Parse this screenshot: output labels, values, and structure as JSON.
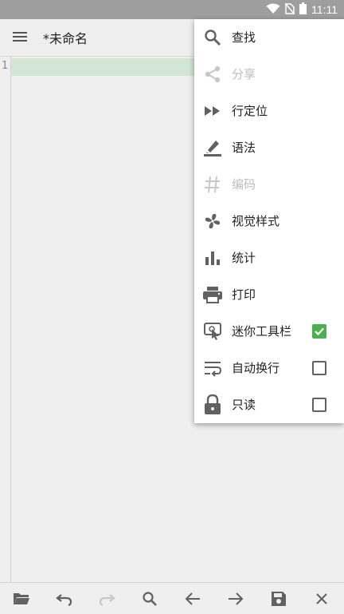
{
  "status_bar": {
    "time": "11:11",
    "icons": [
      "wifi-icon",
      "no-sim-icon",
      "battery-icon"
    ]
  },
  "app_bar": {
    "title": "*未命名",
    "menu_icon": "hamburger-menu-icon"
  },
  "editor": {
    "line_numbers": [
      "1"
    ],
    "text": ""
  },
  "menu": {
    "items": [
      {
        "label": "查找",
        "icon": "search-icon",
        "enabled": true
      },
      {
        "label": "分享",
        "icon": "share-icon",
        "enabled": false
      },
      {
        "label": "行定位",
        "icon": "fast-forward-icon",
        "enabled": true
      },
      {
        "label": "语法",
        "icon": "highlighter-icon",
        "enabled": true
      },
      {
        "label": "编码",
        "icon": "hash-icon",
        "enabled": false
      },
      {
        "label": "视觉样式",
        "icon": "fan-icon",
        "enabled": true
      },
      {
        "label": "统计",
        "icon": "bar-chart-icon",
        "enabled": true
      },
      {
        "label": "打印",
        "icon": "printer-icon",
        "enabled": true
      },
      {
        "label": "迷你工具栏",
        "icon": "touch-icon",
        "enabled": true,
        "checked": true
      },
      {
        "label": "自动换行",
        "icon": "wrap-text-icon",
        "enabled": true,
        "checked": false
      },
      {
        "label": "只读",
        "icon": "lock-icon",
        "enabled": true,
        "checked": false
      }
    ]
  },
  "bottom_bar": {
    "buttons": [
      "folder-open-icon",
      "undo-icon",
      "redo-icon",
      "search-icon",
      "arrow-left-icon",
      "arrow-right-icon",
      "save-icon",
      "close-icon"
    ]
  },
  "colors": {
    "checkbox_checked": "#4caf50",
    "current_line": "#d3e6d4",
    "status_bar": "#9e9e9e",
    "icon": "#616161",
    "icon_disabled": "#c8c8c8"
  }
}
